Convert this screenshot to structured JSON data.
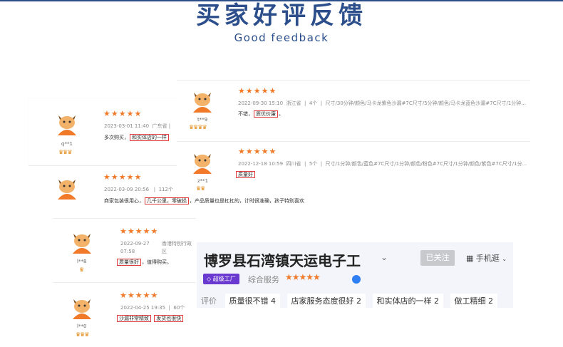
{
  "header": {
    "title": "买家好评反馈",
    "subtitle": "Good feedback"
  },
  "reviews": [
    {
      "user": "q**1",
      "crowns": "♛♛♛",
      "stars": "★★★★★",
      "date": "2023-03-01 11:40",
      "location": "广东省",
      "text_pre": "多次购买，",
      "highlight": "和实体店的一样",
      "text_post": ""
    },
    {
      "user": "t**9",
      "crowns": "♛♛♛♛",
      "stars": "★★★★★",
      "date": "2022-09-30 15:10",
      "location": "浙江省",
      "qty": "4个",
      "sku": "尺寸/30分钟/颜色/马卡龙紫色沙漏#7C尺寸/5分钟/颜色/马卡龙蓝色沙漏#7C尺寸/1分钟...",
      "text_pre": "不错，",
      "highlight": "质优价廉",
      "text_post": "。"
    },
    {
      "user": "",
      "crowns": "",
      "stars": "★★★★★",
      "date": "2022-03-09 20:56",
      "location": "112个",
      "text_pre": "商家包装很用心，",
      "highlight": "几千公里，零破损",
      "text_post": "，产品质量也是杠杠的，计时很准确，孩子特别喜欢"
    },
    {
      "user": "z**1",
      "crowns": "♛♛",
      "stars": "★★★★★",
      "date": "2022-12-18 10:59",
      "location": "四川省",
      "qty": "5个",
      "sku": "尺寸/1分钟/颜色/蓝色#7C尺寸/1分钟/颜色/粉色#7C尺寸/1分钟/颜色/紫色#7C尺寸/1分...",
      "text_pre": "",
      "highlight": "质量好",
      "text_post": ""
    },
    {
      "user": "l**8",
      "crowns": "♛",
      "stars": "★★★★★",
      "date": "2022-09-27 07:58",
      "location": "香港特别行政区",
      "text_pre": "",
      "highlight": "质量很好",
      "text_post": "，值得购买。"
    },
    {
      "user": "l**0",
      "crowns": "♛♛♛",
      "stars": "★★★★★",
      "date": "2022-04-25 19:35",
      "location": "60个",
      "text_pre": "",
      "highlight": "沙漏非常精致",
      "text_post": "",
      "highlight2": "发货也很快"
    }
  ],
  "shop": {
    "name": "博罗县石湾镇天运电子工",
    "follow_label": "已关注",
    "mobile_label": "手机逛",
    "badge": "超级工厂",
    "service_label": "综合服务",
    "service_stars": "★★★★★",
    "tags_label": "评价",
    "tags": [
      "质量很不错 4",
      "店家服务态度很好 2",
      "和实体店的一样 2",
      "做工精细 2"
    ]
  },
  "colors": {
    "accent": "#2c4f8c",
    "highlight": "#e23a3a",
    "star": "#f07a2a",
    "badge": "#6a3ad0"
  }
}
